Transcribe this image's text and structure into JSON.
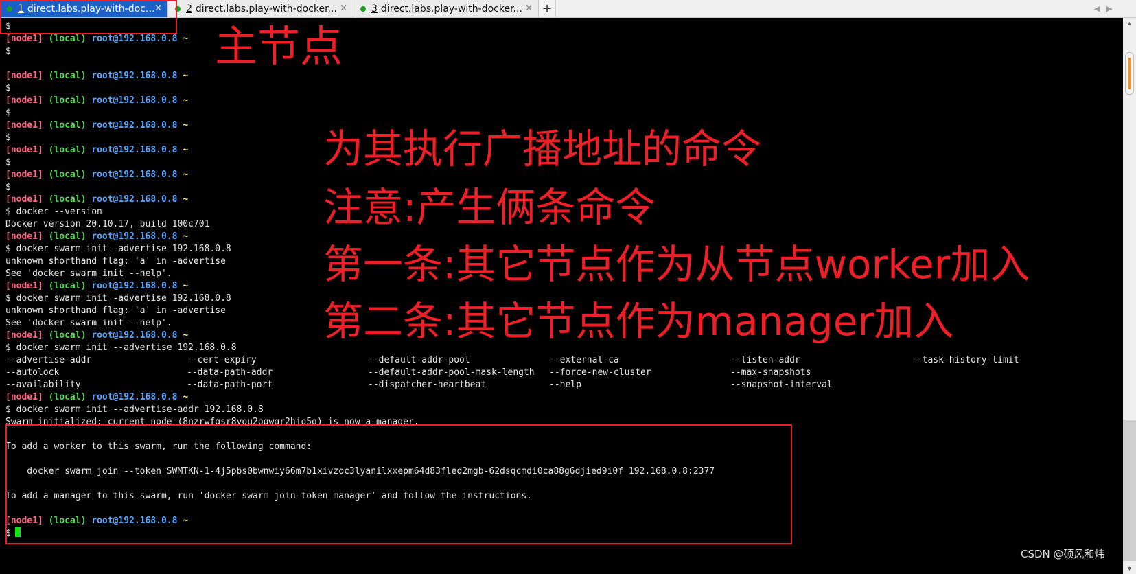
{
  "tabs": [
    {
      "number": "1",
      "title": "direct.labs.play-with-dock...",
      "status_color": "#1ca01c",
      "active": true
    },
    {
      "number": "2",
      "title": "direct.labs.play-with-docker...",
      "status_color": "#1ca01c",
      "active": false
    },
    {
      "number": "3",
      "title": "direct.labs.play-with-docker...",
      "status_color": "#1ca01c",
      "active": false
    }
  ],
  "new_tab_icon": "plus-icon",
  "nav_icons": [
    "chevron-left-icon",
    "chevron-right-icon"
  ],
  "prompt": {
    "node": "[node1]",
    "local": "(local)",
    "user_host": "root@192.168.0.8",
    "path": "~",
    "symbol": "$"
  },
  "terminal_lines": {
    "l01": "$",
    "l06": "$",
    "l07": "$",
    "l08": "$",
    "l09": "$",
    "l10": "$",
    "l11": "$",
    "cmd_version": "$ docker --version",
    "out_version": "Docker version 20.10.17, build 100c701",
    "cmd_init_1": "$ docker swarm init -advertise 192.168.0.8",
    "err_flag_1": "unknown shorthand flag: 'a' in -advertise",
    "err_help_1": "See 'docker swarm init --help'.",
    "cmd_init_2": "$ docker swarm init -advertise 192.168.0.8",
    "err_flag_2": "unknown shorthand flag: 'a' in -advertise",
    "err_help_2": "See 'docker swarm init --help'.",
    "cmd_init_3": "$ docker swarm init --advertise 192.168.0.8",
    "cmd_init_4": "$ docker swarm init --advertise-addr 192.168.0.8",
    "swarm_initialized": "Swarm initialized: current node (8nzrwfgsr8you2oqwgr2hjo5g) is now a manager.",
    "add_worker": "To add a worker to this swarm, run the following command:",
    "join_cmd": "    docker swarm join --token SWMTKN-1-4j5pbs0bwnwiy66m7b1xivzoc3lyanilxxepm64d83fled2mgb-62dsqcmdi0ca88g6djied9i0f 192.168.0.8:2377",
    "add_manager": "To add a manager to this swarm, run 'docker swarm join-token manager' and follow the instructions.",
    "last_prompt": "$"
  },
  "option_columns": [
    [
      "--advertise-addr",
      "--autolock",
      "--availability"
    ],
    [
      "--cert-expiry",
      "--data-path-addr",
      "--data-path-port"
    ],
    [
      "--default-addr-pool",
      "--default-addr-pool-mask-length",
      "--dispatcher-heartbeat"
    ],
    [
      "--external-ca",
      "--force-new-cluster",
      "--help"
    ],
    [
      "--listen-addr",
      "--max-snapshots",
      "--snapshot-interval"
    ],
    [
      "--task-history-limit"
    ]
  ],
  "annotations": {
    "main_node": "主节点",
    "line1": "为其执行广播地址的命令",
    "line2": "注意:产生俩条命令",
    "line3": "第一条:其它节点作为从节点worker加入",
    "line4": "第二条:其它节点作为manager加入",
    "color": "#e8202a"
  },
  "watermark": "CSDN @硕风和炜",
  "colors": {
    "node": "#ff5f7c",
    "local": "#52d852",
    "user_host": "#5aa6ff",
    "tilde": "#f3f35a",
    "cursor": "#17e017",
    "active_tab": "#1c5fc7"
  }
}
